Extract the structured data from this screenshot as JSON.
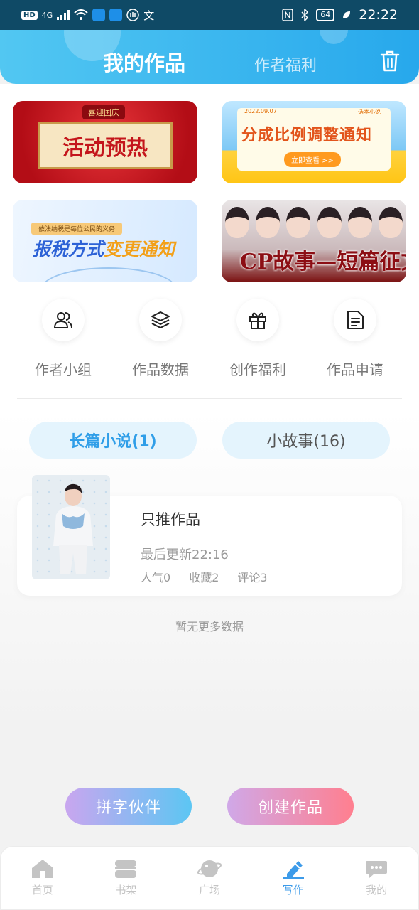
{
  "status_bar": {
    "hd_badge": "HD",
    "network": "4G",
    "battery": "64",
    "time": "22:22",
    "left_extra": "文"
  },
  "header": {
    "active_tab": "我的作品",
    "inactive_tab": "作者福利",
    "trash_icon": "trash-icon",
    "gradient": [
      "#52c7f2",
      "#27a8ec"
    ]
  },
  "banners": [
    {
      "tag": "喜迎国庆",
      "title": "活动预热"
    },
    {
      "date": "2022.09.07",
      "source": "话本小说",
      "title": "分成比例调整通知",
      "button": "立即查看 >>"
    },
    {
      "subtitle": "依法纳税是每位公民的义务",
      "title_main": "报税方式",
      "title_accent": "变更通知"
    },
    {
      "title": "CP故事—短篇征文"
    }
  ],
  "quick_actions": [
    {
      "label": "作者小组",
      "icon": "group-icon"
    },
    {
      "label": "作品数据",
      "icon": "layers-icon"
    },
    {
      "label": "创作福利",
      "icon": "gift-icon"
    },
    {
      "label": "作品申请",
      "icon": "document-icon"
    }
  ],
  "segments": {
    "novel": "长篇小说(1)",
    "story": "小故事(16)"
  },
  "work": {
    "title": "只推作品",
    "updated": "最后更新22:16",
    "popularity": "人气0",
    "favorites": "收藏2",
    "comments": "评论3"
  },
  "no_more": "暂无更多数据",
  "buttons": {
    "partner": "拼字伙伴",
    "create": "创建作品"
  },
  "tabbar": [
    {
      "label": "首页",
      "icon": "home-icon"
    },
    {
      "label": "书架",
      "icon": "bookshelf-icon"
    },
    {
      "label": "广场",
      "icon": "planet-icon"
    },
    {
      "label": "写作",
      "icon": "pen-icon"
    },
    {
      "label": "我的",
      "icon": "chat-icon"
    }
  ],
  "colors": {
    "accent": "#3d9be9",
    "inactive_icon": "#c4c4c4"
  }
}
